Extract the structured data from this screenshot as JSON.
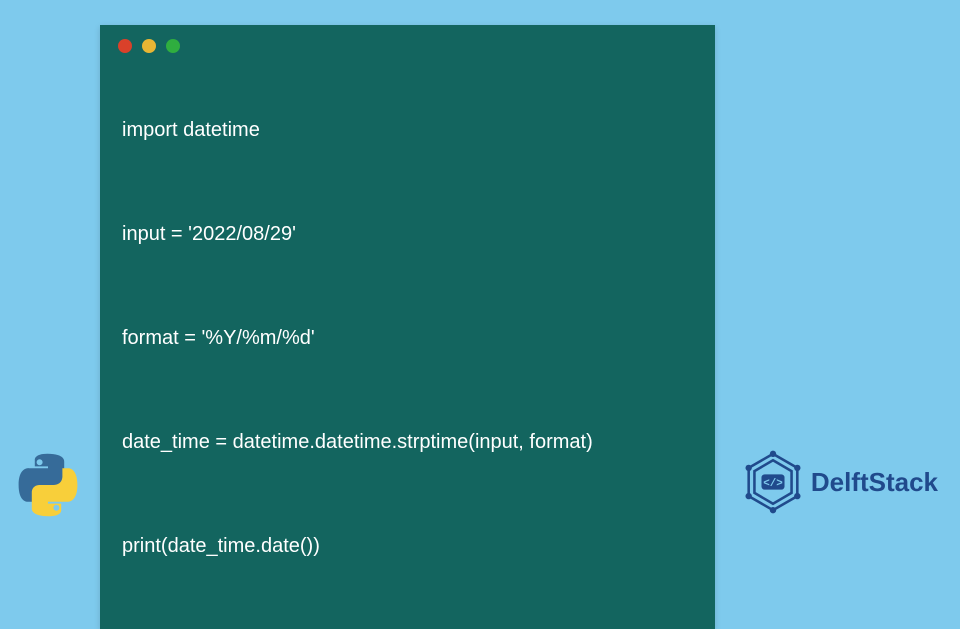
{
  "code": {
    "lines": [
      "import datetime",
      "input = '2022/08/29'",
      "format = '%Y/%m/%d'",
      "date_time = datetime.datetime.strptime(input, format)",
      "print(date_time.date())"
    ]
  },
  "brand": {
    "name": "DelftStack"
  },
  "icons": {
    "window_dots": [
      "red",
      "yellow",
      "green"
    ]
  },
  "colors": {
    "page_bg": "#7ecaed",
    "window_bg": "#13655f",
    "code_text": "#ffffff",
    "brand_text": "#204a8c",
    "dot_red": "#d9412a",
    "dot_yellow": "#e8b634",
    "dot_green": "#2fae3f",
    "python_blue": "#366b99",
    "python_yellow": "#f8cf3a"
  }
}
